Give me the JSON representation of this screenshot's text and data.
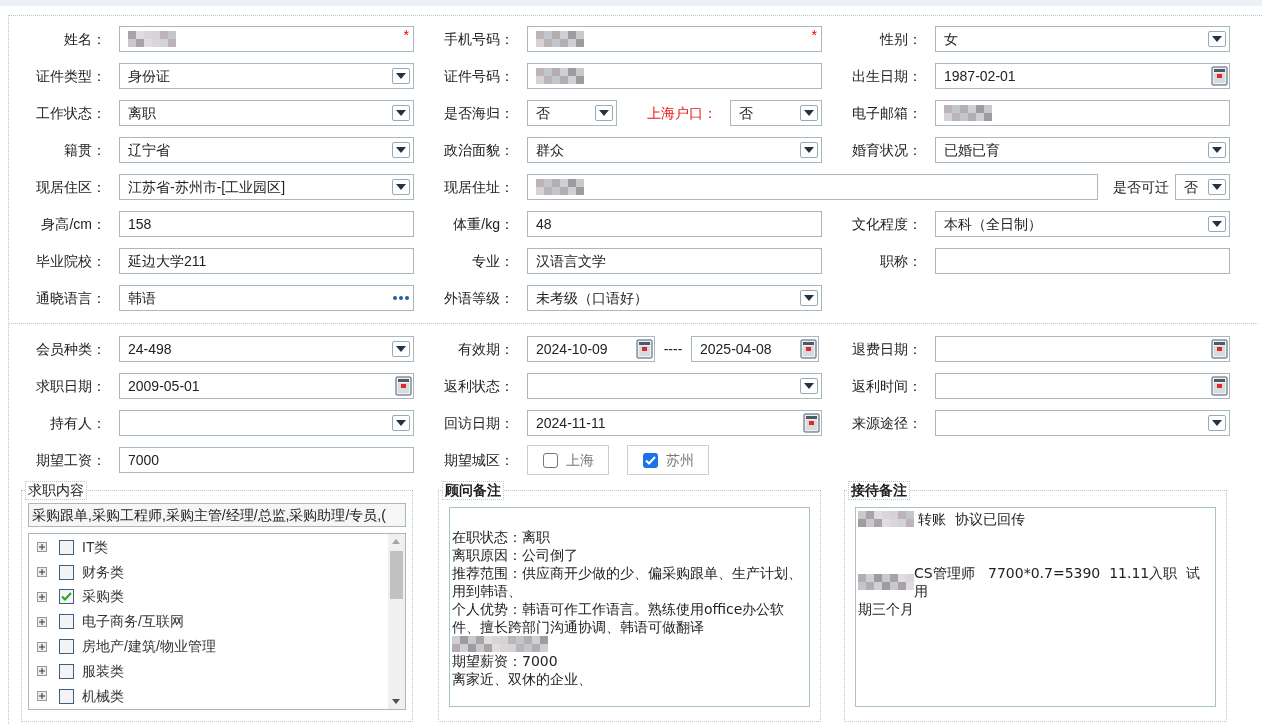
{
  "section_basic": {
    "rows": [
      [
        {
          "label": "姓名：",
          "kind": "text",
          "redacted": true,
          "required_mark": "*"
        },
        {
          "label": "手机号码：",
          "kind": "text",
          "redacted": true,
          "required_mark": "*"
        },
        {
          "label": "性别：",
          "kind": "select",
          "value": "女"
        }
      ],
      [
        {
          "label": "证件类型：",
          "kind": "select",
          "value": "身份证"
        },
        {
          "label": "证件号码：",
          "kind": "text",
          "redacted": true
        },
        {
          "label": "出生日期：",
          "kind": "date",
          "value": "1987-02-01"
        }
      ],
      [
        {
          "label": "工作状态：",
          "kind": "select",
          "value": "离职"
        },
        {
          "label": "是否海归：",
          "kind": "select_pair",
          "value": "否",
          "second": {
            "label": "上海户口：",
            "value": "否",
            "highlight": true
          }
        },
        {
          "label": "电子邮箱：",
          "kind": "text",
          "redacted": true
        }
      ],
      [
        {
          "label": "籍贯：",
          "kind": "select",
          "value": "辽宁省"
        },
        {
          "label": "政治面貌：",
          "kind": "select",
          "value": "群众"
        },
        {
          "label": "婚育状况：",
          "kind": "select",
          "value": "已婚已育"
        }
      ],
      [
        {
          "label": "现居住区：",
          "kind": "select",
          "value": "江苏省-苏州市-[工业园区]"
        },
        {
          "label": "现居住址：",
          "kind": "address",
          "redacted": true,
          "second": {
            "label": "是否可迁",
            "value": "否"
          }
        }
      ],
      [
        {
          "label": "身高/cm：",
          "kind": "text",
          "value": "158"
        },
        {
          "label": "体重/kg：",
          "kind": "text",
          "value": "48"
        },
        {
          "label": "文化程度：",
          "kind": "select",
          "value": "本科（全日制）"
        }
      ],
      [
        {
          "label": "毕业院校：",
          "kind": "text",
          "value": "延边大学211"
        },
        {
          "label": "专业：",
          "kind": "text",
          "value": "汉语言文学"
        },
        {
          "label": "职称：",
          "kind": "text"
        }
      ],
      [
        {
          "label": "通晓语言：",
          "kind": "lookup",
          "value": "韩语"
        },
        {
          "label": "外语等级：",
          "kind": "select",
          "value": "未考级（口语好）"
        }
      ]
    ]
  },
  "section_member": {
    "rows": [
      [
        {
          "label": "会员种类：",
          "kind": "select",
          "value": "24-498"
        },
        {
          "label": "有效期：",
          "kind": "date_range",
          "value": "2024-10-09",
          "separator": "----",
          "value_end": "2025-04-08"
        },
        {
          "label": "退费日期：",
          "kind": "date"
        }
      ],
      [
        {
          "label": "求职日期：",
          "kind": "date",
          "value": "2009-05-01"
        },
        {
          "label": "返利状态：",
          "kind": "select"
        },
        {
          "label": "返利时间：",
          "kind": "date"
        }
      ],
      [
        {
          "label": "持有人：",
          "kind": "select"
        },
        {
          "label": "回访日期：",
          "kind": "date",
          "value": "2024-11-11"
        },
        {
          "label": "来源途径：",
          "kind": "select"
        }
      ],
      [
        {
          "label": "期望工资：",
          "kind": "text",
          "value": "7000"
        },
        {
          "label": "期望城区：",
          "kind": "checks",
          "options": [
            {
              "label": "上海",
              "checked": false
            },
            {
              "label": "苏州",
              "checked": true
            }
          ]
        }
      ]
    ]
  },
  "job_content": {
    "title": "求职内容",
    "selected_text": "采购跟单,采购工程师,采购主管/经理/总监,采购助理/专员,(",
    "tree": [
      {
        "label": "IT类",
        "checked": false
      },
      {
        "label": "财务类",
        "checked": false
      },
      {
        "label": "采购类",
        "checked": true
      },
      {
        "label": "电子商务/互联网",
        "checked": false
      },
      {
        "label": "房地产/建筑/物业管理",
        "checked": false
      },
      {
        "label": "服装类",
        "checked": false
      },
      {
        "label": "机械类",
        "checked": false
      }
    ]
  },
  "consultant_notes": {
    "title": "顾问备注",
    "lines": [
      {
        "text": "在职状态：离职"
      },
      {
        "text": "离职原因：公司倒了"
      },
      {
        "text": "推荐范围：供应商开少做的少、偏采购跟单、生产计划、用到韩语、"
      },
      {
        "text": "个人优势：韩语可作工作语言。熟练使用office办公软件、擅长跨部门沟通协调、韩语可做翻译"
      },
      {
        "redacted": true
      },
      {
        "text": "期望薪资：7000"
      },
      {
        "text": "离家近、双休的企业、"
      }
    ]
  },
  "reception_notes": {
    "title": "接待备注",
    "lines": [
      {
        "redacted": true,
        "text": " 转账  协议已回传"
      },
      {
        "redacted": true,
        "gap_before": true,
        "text": "CS管理师   7700*0.7=5390  11.11入职  试用"
      },
      {
        "text": "期三个月"
      }
    ]
  }
}
